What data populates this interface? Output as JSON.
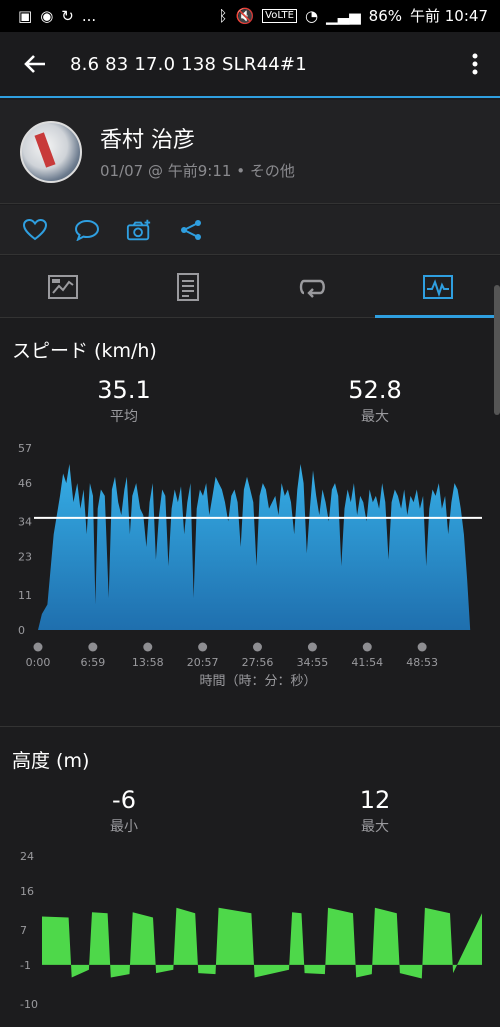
{
  "status_bar": {
    "left_icons": [
      "image-icon",
      "circle-icon",
      "refresh-icon"
    ],
    "left_more": "...",
    "right_icons": [
      "bluetooth-icon",
      "mute-icon",
      "volte-icon",
      "wifi-icon",
      "signal-icon"
    ],
    "battery": "86%",
    "time": "午前 10:47"
  },
  "app_bar": {
    "title": "8.6  83  17.0  138  SLR44#1"
  },
  "profile": {
    "name": "香村 治彦",
    "subtitle": "01/07 @ 午前9:11 • その他"
  },
  "actions": [
    "heart-icon",
    "comment-icon",
    "add-photo-icon",
    "share-icon"
  ],
  "tabs": [
    {
      "icon": "summary-icon",
      "active": false
    },
    {
      "icon": "details-icon",
      "active": false
    },
    {
      "icon": "laps-icon",
      "active": false
    },
    {
      "icon": "chart-icon",
      "active": true
    }
  ],
  "speed_section": {
    "title": "スピード (km/h)",
    "avg_value": "35.1",
    "avg_label": "平均",
    "max_value": "52.8",
    "max_label": "最大"
  },
  "altitude_section": {
    "title": "高度 (m)",
    "min_value": "-6",
    "min_label": "最小",
    "max_value": "12",
    "max_label": "最大"
  },
  "chart_data": [
    {
      "type": "area",
      "title": "スピード (km/h)",
      "xlabel": "時間（時：分：秒）",
      "ylabel": "",
      "x_ticks": [
        "0:00",
        "6:59",
        "13:58",
        "20:57",
        "27:56",
        "34:55",
        "41:54",
        "48:53"
      ],
      "y_ticks": [
        "0",
        "11",
        "23",
        "34",
        "46",
        "57"
      ],
      "ylim": [
        0,
        57
      ],
      "xlim_minutes": [
        0,
        56.5
      ],
      "average_line": 35.1,
      "color": "#2e9fd8",
      "series": [
        {
          "values_minutes": [
            0,
            0.5,
            1.2,
            2,
            2.8,
            3.2,
            3.6,
            4,
            4.5,
            5,
            5.4,
            5.8,
            6.2,
            6.6,
            7,
            7.3,
            7.6,
            8,
            8.5,
            9,
            9.4,
            9.8,
            10.2,
            10.6,
            11,
            11.3,
            11.7,
            12,
            12.5,
            13,
            13.4,
            13.8,
            14.2,
            14.6,
            15,
            15.4,
            15.8,
            16.2,
            16.6,
            17,
            17.4,
            17.8,
            18.2,
            18.6,
            19,
            19.4,
            19.8,
            20.2,
            20.6,
            21,
            21.4,
            21.8,
            22.2,
            22.6,
            23,
            23.4,
            23.8,
            24.2,
            24.6,
            25,
            25.4,
            25.8,
            26.2,
            26.6,
            27,
            27.4,
            27.8,
            28.2,
            28.6,
            29,
            29.4,
            29.8,
            30.2,
            30.6,
            31,
            31.4,
            31.8,
            32.2,
            32.6,
            33,
            33.4,
            33.8,
            34.2,
            34.6,
            35,
            35.4,
            35.8,
            36.2,
            36.6,
            37,
            37.4,
            37.8,
            38.2,
            38.6,
            39,
            39.4,
            39.8,
            40.2,
            40.6,
            41,
            41.4,
            41.8,
            42.2,
            42.6,
            43,
            43.4,
            43.8,
            44.2,
            44.6,
            45,
            45.4,
            45.8,
            46.2,
            46.6,
            47,
            47.4,
            47.8,
            48.2,
            48.6,
            49,
            49.4,
            49.8,
            50.2,
            50.6,
            51,
            51.4,
            51.8,
            52.2,
            52.6,
            53,
            53.4,
            53.8,
            54.2,
            54.6,
            55,
            55.4,
            55.8,
            56.3
          ],
          "values_speed": [
            0,
            5,
            8,
            30,
            42,
            49,
            46,
            52,
            40,
            46,
            38,
            44,
            30,
            46,
            42,
            8,
            38,
            44,
            42,
            10,
            44,
            48,
            40,
            36,
            44,
            48,
            30,
            42,
            46,
            38,
            36,
            26,
            40,
            46,
            22,
            36,
            44,
            42,
            20,
            38,
            44,
            40,
            45,
            30,
            40,
            46,
            10,
            38,
            44,
            42,
            46,
            36,
            42,
            48,
            46,
            44,
            40,
            34,
            42,
            44,
            40,
            26,
            44,
            48,
            44,
            40,
            20,
            42,
            46,
            44,
            38,
            40,
            42,
            36,
            46,
            42,
            44,
            40,
            30,
            44,
            52,
            46,
            24,
            38,
            50,
            42,
            36,
            44,
            40,
            34,
            44,
            46,
            42,
            20,
            38,
            44,
            40,
            46,
            36,
            42,
            40,
            34,
            44,
            40,
            42,
            38,
            46,
            40,
            22,
            40,
            44,
            42,
            38,
            44,
            36,
            42,
            40,
            44,
            38,
            42,
            20,
            38,
            44,
            42,
            46,
            38,
            42,
            30,
            40,
            46,
            44,
            38,
            30,
            16,
            0
          ]
        }
      ]
    },
    {
      "type": "area",
      "title": "高度 (m)",
      "y_ticks": [
        "-10",
        "-1",
        "7",
        "16",
        "24"
      ],
      "ylim": [
        -10,
        24
      ],
      "baseline": -1,
      "color": "#4ed84a",
      "series": [
        {
          "values_minutes": [
            0,
            3.4,
            3.8,
            6,
            6.4,
            8.4,
            8.8,
            11.2,
            11.6,
            14.2,
            14.6,
            16.8,
            17.2,
            19.6,
            20,
            22.2,
            22.6,
            26.8,
            27.2,
            31.6,
            32,
            33.2,
            33.6,
            36.2,
            36.6,
            39.8,
            40.2,
            42.2,
            42.6,
            45.4,
            45.8,
            48.6,
            49,
            52.2,
            52.6,
            56.3
          ],
          "values_altitude": [
            10,
            10,
            -4,
            -2,
            11,
            11,
            -4,
            -3,
            11,
            10,
            -3,
            -2,
            12,
            11,
            -3,
            -3,
            12,
            11,
            -4,
            -2,
            11,
            11,
            -3,
            -3,
            12,
            11,
            -4,
            -3,
            12,
            11,
            -3,
            -4,
            12,
            11,
            -3,
            11
          ]
        }
      ]
    }
  ]
}
